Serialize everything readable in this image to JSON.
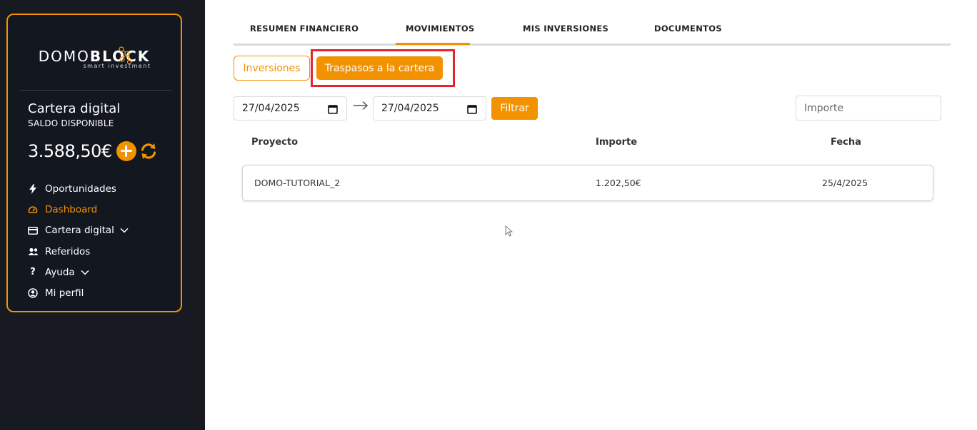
{
  "brand": {
    "name_light": "DOMO",
    "name_bold": "BLOCK",
    "tagline": "smart investment",
    "accent_color": "#f39200"
  },
  "sidebar": {
    "wallet_title": "Cartera digital",
    "wallet_subtitle": "SALDO DISPONIBLE",
    "balance": "3.588,50€",
    "items": [
      {
        "label": "Oportunidades",
        "icon": "bolt-icon"
      },
      {
        "label": "Dashboard",
        "icon": "dashboard-icon",
        "active": true
      },
      {
        "label": "Cartera digital",
        "icon": "card-icon",
        "expandable": true
      },
      {
        "label": "Referidos",
        "icon": "users-icon"
      },
      {
        "label": "Ayuda",
        "icon": "question-icon",
        "expandable": true
      },
      {
        "label": "Mi perfil",
        "icon": "user-circle-icon"
      }
    ]
  },
  "tabs": [
    {
      "label": "RESUMEN FINANCIERO"
    },
    {
      "label": "MOVIMIENTOS",
      "active": true
    },
    {
      "label": "MIS INVERSIONES"
    },
    {
      "label": "DOCUMENTOS"
    }
  ],
  "subtabs": {
    "inversiones": "Inversiones",
    "traspasos": "Traspasos a la cartera"
  },
  "filters": {
    "date_from": "27/04/2025",
    "date_to": "27/04/2025",
    "filter_label": "Filtrar",
    "amount_placeholder": "Importe"
  },
  "table": {
    "headers": [
      "Proyecto",
      "Importe",
      "Fecha"
    ],
    "rows": [
      [
        "DOMO-TUTORIAL_2",
        "1.202,50€",
        "25/4/2025"
      ]
    ]
  },
  "annotation_color": "#e3262b"
}
